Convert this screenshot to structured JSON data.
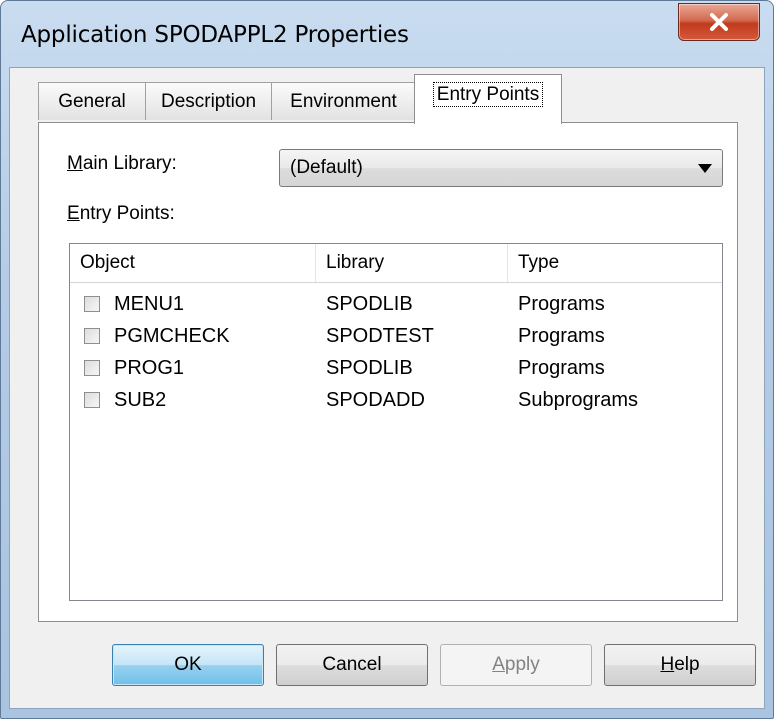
{
  "window": {
    "title": "Application SPODAPPL2 Properties"
  },
  "tabs": [
    {
      "label": "General"
    },
    {
      "label": "Description"
    },
    {
      "label": "Environment"
    },
    {
      "label": "Entry Points",
      "active": true
    }
  ],
  "main_library": {
    "label_mnemonic": "M",
    "label_rest": "ain Library:",
    "selected": "(Default)"
  },
  "entry_points": {
    "label_mnemonic": "E",
    "label_rest": "ntry Points:",
    "columns": [
      "Object",
      "Library",
      "Type"
    ],
    "rows": [
      {
        "object": "MENU1",
        "library": "SPODLIB",
        "type": "Programs",
        "checked": false
      },
      {
        "object": "PGMCHECK",
        "library": "SPODTEST",
        "type": "Programs",
        "checked": false
      },
      {
        "object": "PROG1",
        "library": "SPODLIB",
        "type": "Programs",
        "checked": false
      },
      {
        "object": "SUB2",
        "library": "SPODADD",
        "type": "Subprograms",
        "checked": false
      }
    ]
  },
  "buttons": {
    "ok": "OK",
    "cancel": "Cancel",
    "apply_mnemonic": "A",
    "apply_rest": "pply",
    "help_mnemonic": "H",
    "help_rest": "elp"
  },
  "colors": {
    "title_bar": "#b4cce6",
    "close_button": "#c23a1c",
    "default_button": "#98d1ef"
  },
  "icons": [
    "close-icon",
    "chevron-down-icon"
  ]
}
